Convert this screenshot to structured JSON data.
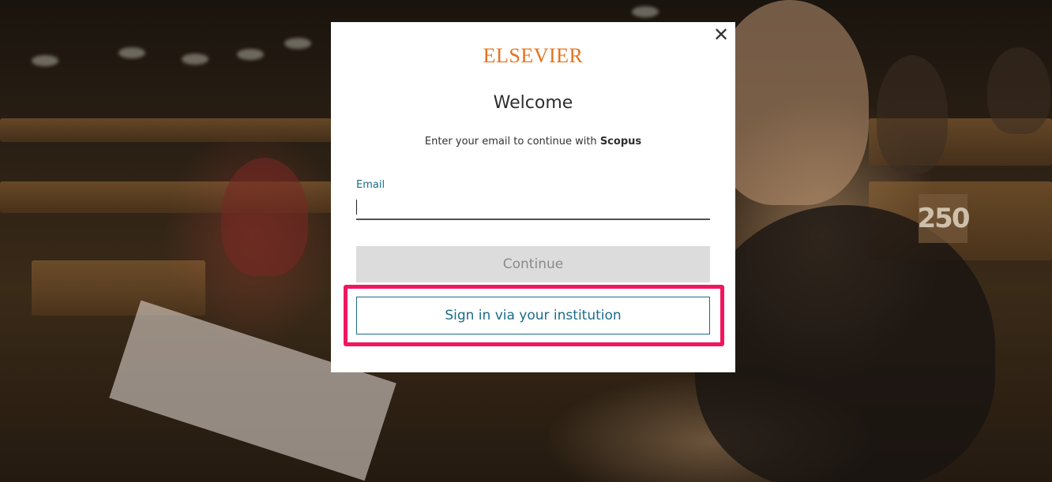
{
  "modal": {
    "close_icon": "close-icon",
    "close_glyph": "✕",
    "logo_text": "ELSEVIER",
    "title": "Welcome",
    "subtitle_prefix": "Enter your email to continue with",
    "subtitle_product": "Scopus",
    "email": {
      "label": "Email",
      "value": "",
      "placeholder": ""
    },
    "continue_label": "Continue",
    "institution_label": "Sign in via your institution"
  },
  "backdrop": {
    "seat_number": "250"
  },
  "colors": {
    "brand_orange": "#e9711c",
    "accent_teal": "#1a6c8a",
    "highlight_pink": "#f0165f",
    "disabled_gray": "#dcdcdc"
  }
}
